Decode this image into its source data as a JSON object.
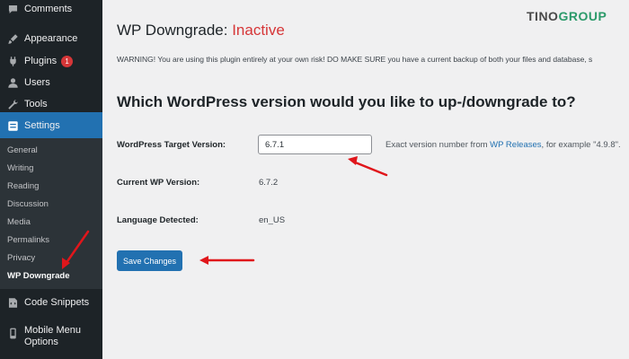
{
  "sidebar": {
    "menu": [
      {
        "label": "Comments",
        "icon": "comment-icon"
      },
      {
        "label": "Appearance",
        "icon": "brush-icon"
      },
      {
        "label": "Plugins",
        "icon": "plugin-icon",
        "badge": "1"
      },
      {
        "label": "Users",
        "icon": "user-icon"
      },
      {
        "label": "Tools",
        "icon": "wrench-icon"
      },
      {
        "label": "Settings",
        "icon": "settings-icon"
      }
    ],
    "submenu": [
      "General",
      "Writing",
      "Reading",
      "Discussion",
      "Media",
      "Permalinks",
      "Privacy",
      "WP Downgrade"
    ],
    "after": [
      {
        "label": "Code Snippets",
        "icon": "code-icon"
      },
      {
        "label": "Mobile Menu Options",
        "icon": "mobile-icon"
      }
    ]
  },
  "page": {
    "title": "WP Downgrade:",
    "status": "Inactive",
    "logo_part1": "TINO",
    "logo_part2": "GROUP",
    "warning": "WARNING! You are using this plugin entirely at your own risk! DO MAKE SURE you have a current backup of both your files and database, s",
    "heading": "Which WordPress version would you like to up-/downgrade to?",
    "target_label": "WordPress Target Version:",
    "target_value": "6.7.1",
    "hint_prefix": "Exact version number from ",
    "hint_link": "WP Releases",
    "hint_suffix": ", for example \"4.9.8\".",
    "current_label": "Current WP Version:",
    "current_value": "6.7.2",
    "lang_label": "Language Detected:",
    "lang_value": "en_US",
    "save_label": "Save Changes"
  },
  "colors": {
    "accent": "#2271b1",
    "danger": "#d63638",
    "annotation_arrow": "#e0161b"
  }
}
